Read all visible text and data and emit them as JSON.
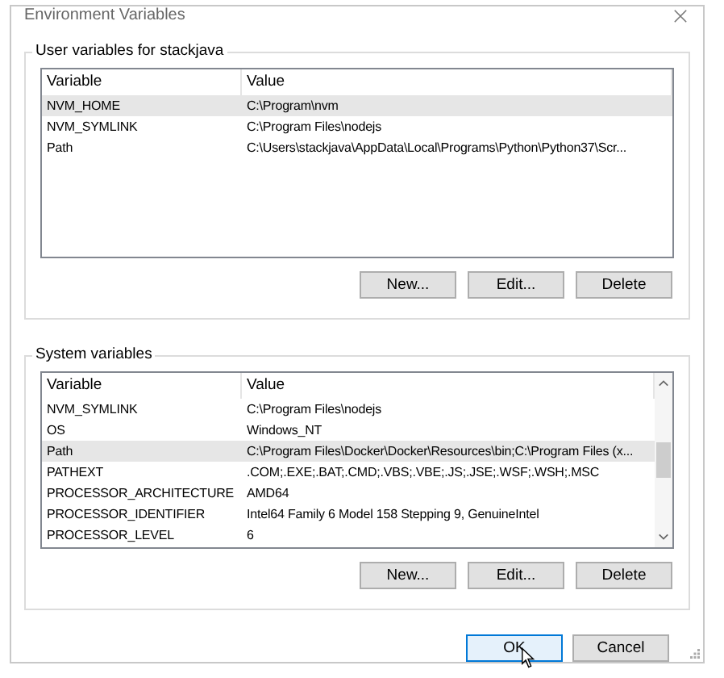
{
  "window": {
    "title": "Environment Variables"
  },
  "user_variables": {
    "title": "User variables for stackjava",
    "columns": [
      "Variable",
      "Value"
    ],
    "rows": [
      {
        "variable": "NVM_HOME",
        "value": "C:\\Program\\nvm",
        "selected": true
      },
      {
        "variable": "NVM_SYMLINK",
        "value": "C:\\Program Files\\nodejs",
        "selected": false
      },
      {
        "variable": "Path",
        "value": "C:\\Users\\stackjava\\AppData\\Local\\Programs\\Python\\Python37\\Scr...",
        "selected": false
      }
    ],
    "buttons": [
      "New...",
      "Edit...",
      "Delete"
    ]
  },
  "system_variables": {
    "title": "System variables",
    "columns": [
      "Variable",
      "Value"
    ],
    "rows": [
      {
        "variable": "NVM_SYMLINK",
        "value": "C:\\Program Files\\nodejs",
        "selected": false
      },
      {
        "variable": "OS",
        "value": "Windows_NT",
        "selected": false
      },
      {
        "variable": "Path",
        "value": "C:\\Program Files\\Docker\\Docker\\Resources\\bin;C:\\Program Files (x...",
        "selected": true
      },
      {
        "variable": "PATHEXT",
        "value": ".COM;.EXE;.BAT;.CMD;.VBS;.VBE;.JS;.JSE;.WSF;.WSH;.MSC",
        "selected": false
      },
      {
        "variable": "PROCESSOR_ARCHITECTURE",
        "value": "AMD64",
        "selected": false
      },
      {
        "variable": "PROCESSOR_IDENTIFIER",
        "value": "Intel64 Family 6 Model 158 Stepping 9, GenuineIntel",
        "selected": false
      },
      {
        "variable": "PROCESSOR_LEVEL",
        "value": "6",
        "selected": false
      }
    ],
    "buttons": [
      "New...",
      "Edit...",
      "Delete"
    ]
  },
  "dialog_buttons": [
    {
      "label": "OK",
      "default": true
    },
    {
      "label": "Cancel",
      "default": false
    }
  ]
}
